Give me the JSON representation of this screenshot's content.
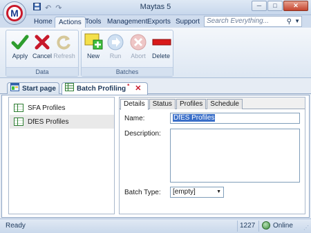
{
  "window": {
    "title": "Maytas 5",
    "app_logo_letter": "M",
    "buttons": {
      "minimize": "─",
      "maximize": "□",
      "close": "✕"
    }
  },
  "quick_access": {
    "save_icon": "save-icon",
    "undo_icon": "undo-icon",
    "redo_icon": "redo-icon"
  },
  "menu": {
    "tabs": [
      "Home",
      "Actions",
      "Tools",
      "Management",
      "Exports",
      "Support"
    ],
    "active": "Actions"
  },
  "search": {
    "placeholder": "Search Everything..."
  },
  "ribbon": {
    "data_group": {
      "label": "Data",
      "buttons": [
        {
          "label": "Apply",
          "icon": "check-icon",
          "enabled": true
        },
        {
          "label": "Cancel",
          "icon": "x-icon",
          "enabled": true
        },
        {
          "label": "Refresh",
          "icon": "refresh-icon",
          "enabled": false
        }
      ]
    },
    "batches_group": {
      "label": "Batches",
      "buttons": [
        {
          "label": "New",
          "icon": "new-icon",
          "enabled": true
        },
        {
          "label": "Run",
          "icon": "run-icon",
          "enabled": false
        },
        {
          "label": "Abort",
          "icon": "abort-icon",
          "enabled": false
        },
        {
          "label": "Delete",
          "icon": "delete-icon",
          "enabled": true
        }
      ]
    }
  },
  "doc_tabs": [
    {
      "label": "Start page",
      "active": false
    },
    {
      "label": "Batch Profiling",
      "active": true,
      "dirty_marker": "*"
    }
  ],
  "profiles": {
    "items": [
      {
        "label": "SFA Profiles",
        "selected": false
      },
      {
        "label": "DfES Profiles",
        "selected": true
      }
    ]
  },
  "details": {
    "tabs": [
      "Details",
      "Status",
      "Profiles",
      "Schedule"
    ],
    "active_tab": "Details",
    "name_label": "Name:",
    "name_value": "DfES Profiles",
    "description_label": "Description:",
    "description_value": "",
    "batch_type_label": "Batch Type:",
    "batch_type_value": "[empty]"
  },
  "status_bar": {
    "status": "Ready",
    "count": "1227",
    "connection": "Online"
  },
  "colors": {
    "accent_blue": "#1e395b",
    "apply_green": "#2e9d2e",
    "cancel_red": "#c8192b",
    "delete_red": "#d91a1a",
    "selection_blue": "#3a6fc9"
  }
}
